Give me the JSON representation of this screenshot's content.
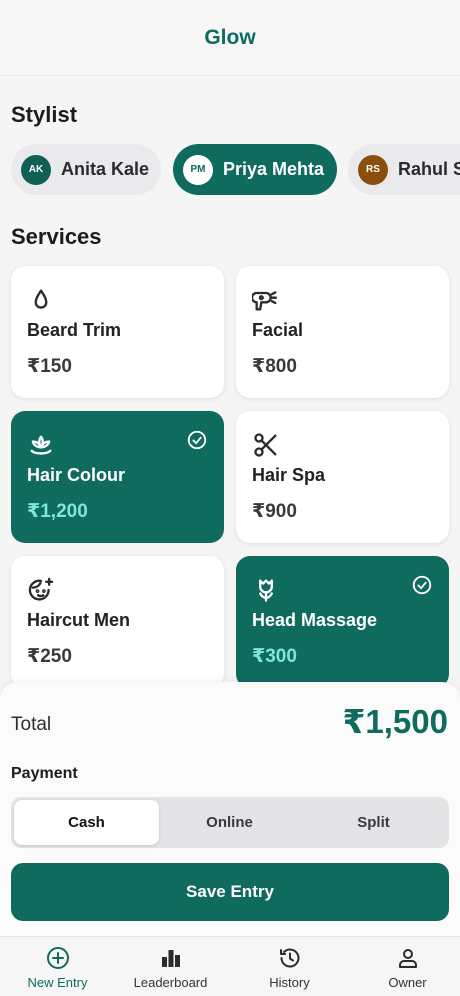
{
  "app": {
    "title": "Glow"
  },
  "stylist_section": {
    "title": "Stylist",
    "stylists": [
      {
        "initials": "AK",
        "name": "Anita Kale",
        "avatar_bg": "#0f5f54",
        "selected": false
      },
      {
        "initials": "PM",
        "name": "Priya Mehta",
        "avatar_bg": "#ffffff",
        "selected": true
      },
      {
        "initials": "RS",
        "name": "Rahul S",
        "avatar_bg": "#8a4f0c",
        "selected": false
      }
    ]
  },
  "services_section": {
    "title": "Services",
    "services": [
      {
        "name": "Beard Trim",
        "price": "₹150",
        "icon": "droplet-icon",
        "selected": false
      },
      {
        "name": "Facial",
        "price": "₹800",
        "icon": "hair-dryer-icon",
        "selected": false
      },
      {
        "name": "Hair Colour",
        "price": "₹1,200",
        "icon": "lotus-icon",
        "selected": true
      },
      {
        "name": "Hair Spa",
        "price": "₹900",
        "icon": "scissors-icon",
        "selected": false
      },
      {
        "name": "Haircut Men",
        "price": "₹250",
        "icon": "face-sparkle-icon",
        "selected": false
      },
      {
        "name": "Head Massage",
        "price": "₹300",
        "icon": "tulip-icon",
        "selected": true
      }
    ]
  },
  "summary": {
    "total_label": "Total",
    "total_value": "₹1,500",
    "payment_label": "Payment",
    "payment_options": [
      {
        "label": "Cash",
        "selected": true
      },
      {
        "label": "Online",
        "selected": false
      },
      {
        "label": "Split",
        "selected": false
      }
    ],
    "save_label": "Save Entry"
  },
  "tabs": [
    {
      "label": "New Entry",
      "icon": "plus-circle-icon",
      "active": true
    },
    {
      "label": "Leaderboard",
      "icon": "bar-chart-icon",
      "active": false
    },
    {
      "label": "History",
      "icon": "history-icon",
      "active": false
    },
    {
      "label": "Owner",
      "icon": "user-icon",
      "active": false
    }
  ],
  "colors": {
    "accent": "#0f6b5e",
    "accent_light": "#7de8d6",
    "background": "#f5f5f6"
  }
}
